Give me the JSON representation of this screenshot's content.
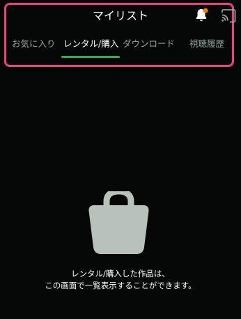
{
  "header": {
    "title": "マイリスト",
    "icons": {
      "notifications": "bell-icon",
      "cast": "cast-icon"
    },
    "notification_dot_color": "#ff7a00",
    "highlight_color": "#e8447a"
  },
  "tabs": [
    {
      "label": "お気に入り",
      "active": false
    },
    {
      "label": "レンタル/購入",
      "active": true
    },
    {
      "label": "ダウンロード",
      "active": false
    },
    {
      "label": "視聴履歴",
      "active": false
    }
  ],
  "active_tab_color": "#2fae4a",
  "empty_state": {
    "icon": "shopping-bag-icon",
    "line1": "レンタル/購入した作品は、",
    "line2": "この画面で一覧表示することができます。"
  }
}
